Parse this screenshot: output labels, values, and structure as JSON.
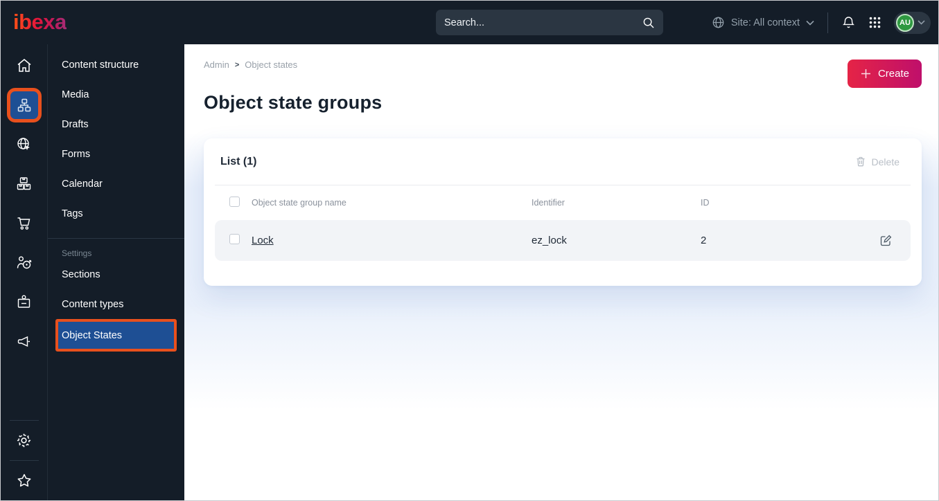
{
  "topbar": {
    "logo": "ibexa",
    "search_placeholder": "Search...",
    "site_context_label": "Site: All context",
    "avatar_initials": "AU"
  },
  "icon_rail": {
    "icons": [
      "home",
      "content-tree",
      "site-globe",
      "product-boxes",
      "commerce-cart",
      "audience-target",
      "corporate-badge",
      "megaphone",
      "settings-gear",
      "bookmarks-star"
    ],
    "active_icon": "content-tree"
  },
  "sidebar": {
    "items": [
      "Content structure",
      "Media",
      "Drafts",
      "Forms",
      "Calendar",
      "Tags"
    ],
    "settings_heading": "Settings",
    "settings_items": [
      "Sections",
      "Content types",
      "Object States"
    ],
    "active_item": "Object States"
  },
  "breadcrumb": {
    "items": [
      "Admin",
      "Object states"
    ],
    "separator": ">"
  },
  "page": {
    "title": "Object state groups"
  },
  "actions": {
    "create_label": "Create"
  },
  "card": {
    "title": "List (1)",
    "delete_label": "Delete",
    "table": {
      "columns": [
        "Object state group name",
        "Identifier",
        "ID"
      ],
      "rows": [
        {
          "name": "Lock",
          "identifier": "ez_lock",
          "id": "2"
        }
      ]
    }
  },
  "colors": {
    "topbar_bg": "#141d28",
    "highlight_blue": "#1e4f94",
    "annotation_orange": "#e8501d",
    "create_gradient_start": "#e52446",
    "create_gradient_end": "#bf0f6b",
    "avatar_green": "#2e9940",
    "row_bg": "#f2f4f7",
    "halo_blue": "#e9f0fb"
  }
}
